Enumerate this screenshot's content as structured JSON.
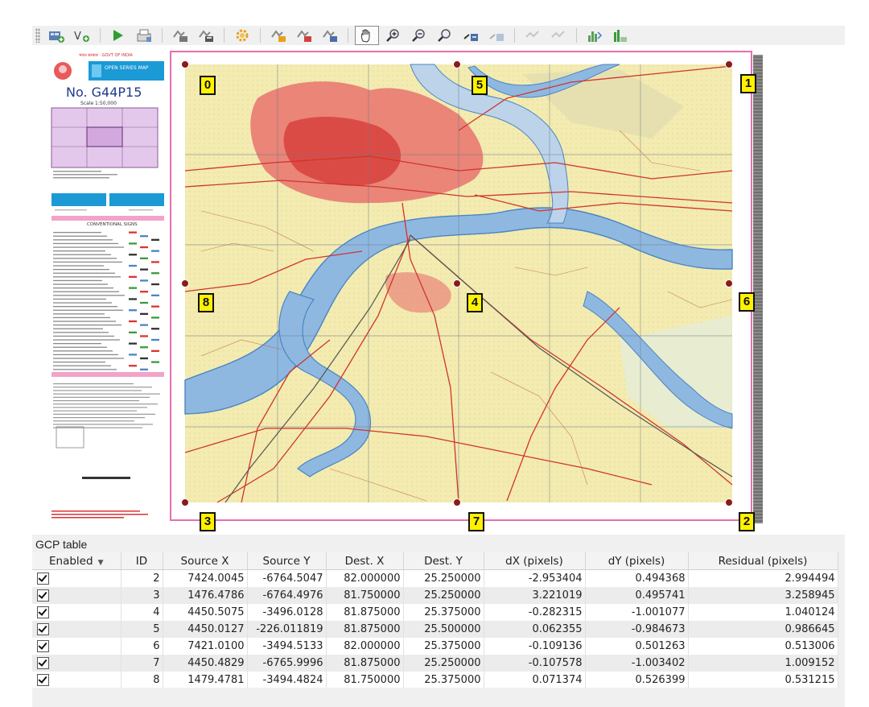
{
  "toolbar": {
    "buttons": [
      {
        "name": "add-raster-button",
        "icon": "add-raster-icon"
      },
      {
        "name": "add-vector-button",
        "icon": "add-vector-icon"
      },
      {
        "name": "start-georeferencing-button",
        "icon": "play-icon"
      },
      {
        "name": "generate-gdal-script-button",
        "icon": "script-icon"
      },
      {
        "name": "load-gcp-points-button",
        "icon": "load-points-icon"
      },
      {
        "name": "save-gcp-points-button",
        "icon": "save-points-icon"
      },
      {
        "name": "transformation-settings-button",
        "icon": "gear-icon"
      },
      {
        "name": "add-point-button",
        "icon": "add-point-icon"
      },
      {
        "name": "delete-point-button",
        "icon": "delete-point-icon"
      },
      {
        "name": "move-gcp-button",
        "icon": "move-point-icon"
      },
      {
        "name": "pan-button",
        "icon": "hand-icon"
      },
      {
        "name": "zoom-in-button",
        "icon": "zoom-in-icon"
      },
      {
        "name": "zoom-out-button",
        "icon": "zoom-out-icon"
      },
      {
        "name": "zoom-to-layer-button",
        "icon": "zoom-layer-icon"
      },
      {
        "name": "zoom-last-button",
        "icon": "zoom-last-icon"
      },
      {
        "name": "zoom-next-button",
        "icon": "zoom-next-icon"
      },
      {
        "name": "link-georeferencer-button",
        "icon": "link-icon"
      },
      {
        "name": "link-qgis-button",
        "icon": "link-qgis-icon"
      },
      {
        "name": "histogram-stretch-button",
        "icon": "histogram-icon"
      },
      {
        "name": "local-histogram-button",
        "icon": "local-histogram-icon"
      }
    ]
  },
  "map": {
    "sheet_number": "No. G44P15",
    "scale_text": "Scale 1:50,000",
    "series_text": "OPEN SERIES MAP",
    "legend_heading": "CONVENTIONAL SIGNS",
    "gcp_labels": [
      "0",
      "1",
      "2",
      "3",
      "4",
      "5",
      "6",
      "7",
      "8"
    ]
  },
  "gcp_table": {
    "title": "GCP table",
    "columns": [
      "Enabled",
      "ID",
      "Source X",
      "Source Y",
      "Dest. X",
      "Dest. Y",
      "dX (pixels)",
      "dY (pixels)",
      "Residual (pixels)"
    ],
    "rows": [
      {
        "enabled": true,
        "id": "2",
        "src_x": "7424.0045",
        "src_y": "-6764.5047",
        "dst_x": "82.000000",
        "dst_y": "25.250000",
        "dx": "-2.953404",
        "dy": "0.494368",
        "res": "2.994494"
      },
      {
        "enabled": true,
        "id": "3",
        "src_x": "1476.4786",
        "src_y": "-6764.4976",
        "dst_x": "81.750000",
        "dst_y": "25.250000",
        "dx": "3.221019",
        "dy": "0.495741",
        "res": "3.258945"
      },
      {
        "enabled": true,
        "id": "4",
        "src_x": "4450.5075",
        "src_y": "-3496.0128",
        "dst_x": "81.875000",
        "dst_y": "25.375000",
        "dx": "-0.282315",
        "dy": "-1.001077",
        "res": "1.040124"
      },
      {
        "enabled": true,
        "id": "5",
        "src_x": "4450.0127",
        "src_y": "-226.011819",
        "dst_x": "81.875000",
        "dst_y": "25.500000",
        "dx": "0.062355",
        "dy": "-0.984673",
        "res": "0.986645"
      },
      {
        "enabled": true,
        "id": "6",
        "src_x": "7421.0100",
        "src_y": "-3494.5133",
        "dst_x": "82.000000",
        "dst_y": "25.375000",
        "dx": "-0.109136",
        "dy": "0.501263",
        "res": "0.513006"
      },
      {
        "enabled": true,
        "id": "7",
        "src_x": "4450.4829",
        "src_y": "-6765.9996",
        "dst_x": "81.875000",
        "dst_y": "25.250000",
        "dx": "-0.107578",
        "dy": "-1.003402",
        "res": "1.009152"
      },
      {
        "enabled": true,
        "id": "8",
        "src_x": "1479.4781",
        "src_y": "-3494.4824",
        "dst_x": "81.750000",
        "dst_y": "25.375000",
        "dx": "0.071374",
        "dy": "0.526399",
        "res": "0.531215"
      }
    ]
  },
  "colors": {
    "gcp_label_fill": "#fff200",
    "gcp_marker": "#8b1a1a",
    "river": "#8fb8e0",
    "urban": "#e8736f",
    "land": "#f3ebb0",
    "road": "#d0342c",
    "sheet_border": "#e56fb0"
  }
}
